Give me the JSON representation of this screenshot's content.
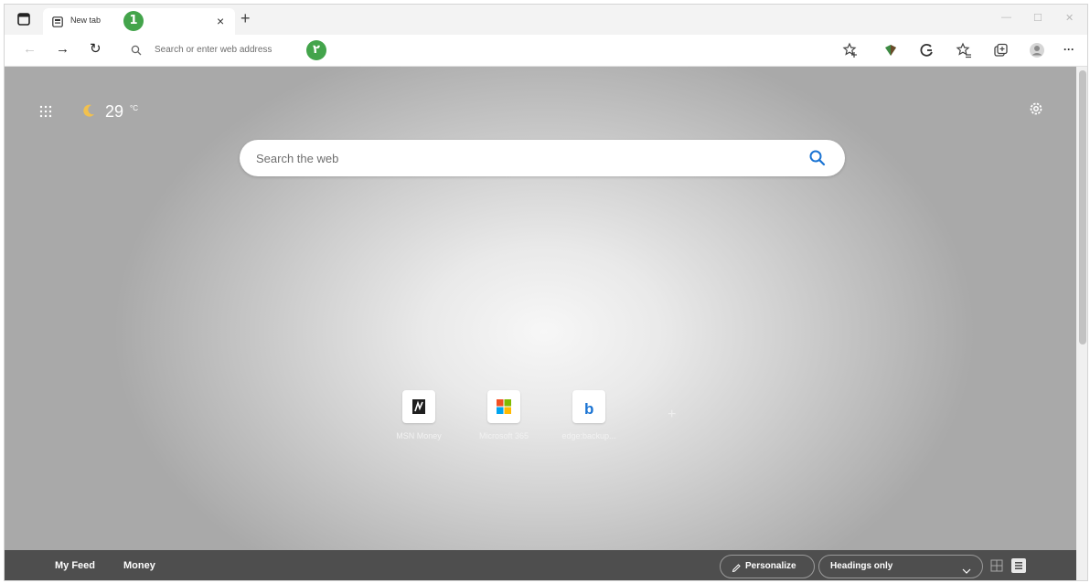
{
  "tab": {
    "title": "New tab",
    "close_glyph": "×",
    "new_tab_glyph": "+",
    "callout_number": "1"
  },
  "window": {
    "minimize_glyph": "—",
    "maximize_glyph": "☐",
    "close_glyph": "✕"
  },
  "toolbar": {
    "back_glyph": "←",
    "forward_glyph": "→",
    "refresh_glyph": "↻",
    "address_placeholder": "Search or enter web address",
    "callout_number": "۲",
    "more_glyph": "···",
    "icons": [
      "add-favorite-icon",
      "extension-icon",
      "browser-essentials-icon",
      "favorites-icon",
      "collections-icon",
      "profile-avatar-icon",
      "more-options-icon"
    ]
  },
  "new_tab_page": {
    "weather_temp": "29",
    "weather_unit": "°C",
    "search_placeholder": "Search the web",
    "quick_links": [
      {
        "label": "MSN Money",
        "icon": "msn-money-icon"
      },
      {
        "label": "Microsoft 365",
        "icon": "microsoft-logo-icon"
      },
      {
        "label": "edge:backup...",
        "icon": "bing-logo-icon"
      }
    ],
    "add_site_glyph": "+"
  },
  "feed_bar": {
    "tabs": [
      "My Feed",
      "Money"
    ],
    "personalize_label": "Personalize",
    "layout_select_value": "Headings only"
  },
  "colors": {
    "callout_green": "#43a44b",
    "bing_blue": "#1b74d3",
    "bottom_bar": "#4e4e4e"
  }
}
